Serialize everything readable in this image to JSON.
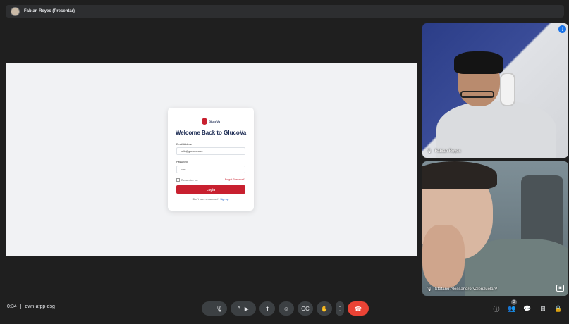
{
  "presenter_bar": {
    "label": "Fabian Reyes (Presentar)"
  },
  "shared_screen": {
    "logo_text": "GlucoVa",
    "heading": "Welcome Back to GlucoVa",
    "email_label": "Email Address",
    "email_value": "hello@glucova.com",
    "password_label": "Password",
    "password_value": "••••••",
    "remember_label": "Remember me",
    "forgot_label": "Forgot Password?",
    "login_label": "Login",
    "signup_prompt": "Don't have an account?",
    "signup_link": "Sign up",
    "brand_color": "#c8202f"
  },
  "tiles": [
    {
      "name": "Fabian Reyes"
    },
    {
      "name": "Stefano Alessandro Valenzuela V"
    }
  ],
  "meeting": {
    "time": "0:34",
    "separator": "|",
    "code": "dwn-afpp-dsg"
  },
  "controls": {
    "more_options": "⋯",
    "mic": "🎙",
    "chevron": "^",
    "camera": "▶",
    "present": "⬆",
    "emoji": "☺",
    "captions": "CC",
    "raise_hand": "✋",
    "more": "⋮",
    "end_call": "☎"
  },
  "right_controls": {
    "info": "ⓘ",
    "people": "👥",
    "people_count": "3",
    "chat": "💬",
    "activities": "⊞",
    "host": "🔒"
  }
}
